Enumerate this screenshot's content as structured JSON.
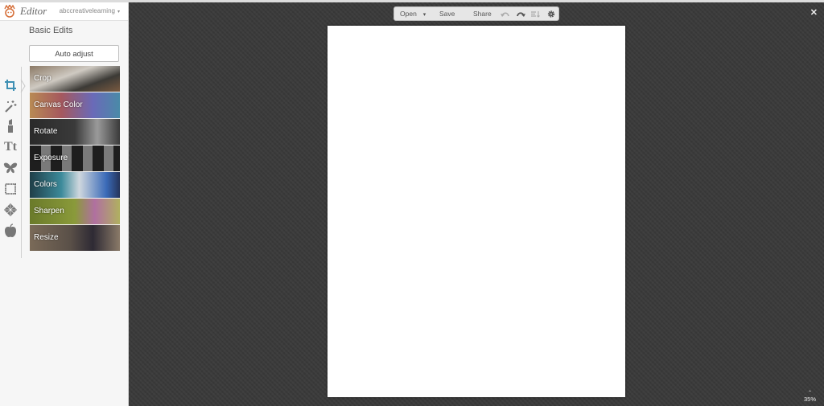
{
  "app": {
    "logo_text": "Editor",
    "user_name": "abccreativelearning",
    "user_caret": "▾"
  },
  "sidebar": {
    "section_title": "Basic Edits",
    "auto_adjust_label": "Auto adjust",
    "rail_icons": [
      {
        "name": "crop-icon",
        "active": true
      },
      {
        "name": "magic-wand-icon",
        "active": false
      },
      {
        "name": "lipstick-icon",
        "active": false
      },
      {
        "name": "text-icon",
        "active": false
      },
      {
        "name": "butterfly-icon",
        "active": false
      },
      {
        "name": "frame-icon",
        "active": false
      },
      {
        "name": "texture-icon",
        "active": false
      },
      {
        "name": "apple-icon",
        "active": false
      }
    ],
    "tools": [
      {
        "label": "Crop",
        "color_a": "#8a7864",
        "color_b": "#3c3a36"
      },
      {
        "label": "Canvas Color",
        "color_a": "#b88a54",
        "color_b": "#6a6ab8"
      },
      {
        "label": "Rotate",
        "color_a": "#2a2a2a",
        "color_b": "#6e6e6e"
      },
      {
        "label": "Exposure",
        "color_a": "#1e1e1e",
        "color_b": "#7a7a7a"
      },
      {
        "label": "Colors",
        "color_a": "#2f5a62",
        "color_b": "#3a6ab8"
      },
      {
        "label": "Sharpen",
        "color_a": "#6a7a2a",
        "color_b": "#b0b060"
      },
      {
        "label": "Resize",
        "color_a": "#7a6a58",
        "color_b": "#4a4040"
      }
    ]
  },
  "toolbar": {
    "open_label": "Open",
    "open_caret": "▾",
    "save_label": "Save",
    "share_label": "Share"
  },
  "window": {
    "close_glyph": "✕"
  },
  "status": {
    "zoom_up": "⌃",
    "zoom_level": "35%"
  }
}
